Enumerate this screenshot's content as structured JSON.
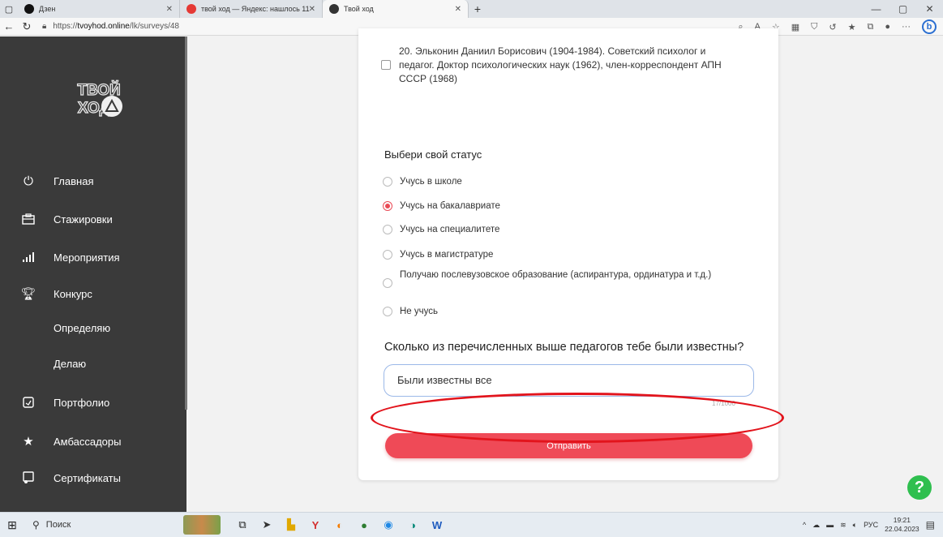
{
  "browser": {
    "tabs": [
      {
        "title": "Дзен",
        "favicon_color": "#111111"
      },
      {
        "title": "твой ход — Яндекс: нашлось 11",
        "favicon_color": "#e53935"
      },
      {
        "title": "Твой ход",
        "favicon_color": "#333333"
      }
    ],
    "url_prefix": "https://",
    "url_host": "tvoyhod.online",
    "url_path": "/lk/surveys/48",
    "new_tab": "+",
    "win_minimize": "—",
    "win_restore": "▢",
    "win_close": "✕",
    "more": "···",
    "bing": "b"
  },
  "sidebar": {
    "logo_lines": [
      "ТВОЙ",
      "ХОД"
    ],
    "items": [
      {
        "label": "Главная",
        "icon": "power-icon"
      },
      {
        "label": "Стажировки",
        "icon": "briefcase-icon"
      },
      {
        "label": "Мероприятия",
        "icon": "bars-icon"
      },
      {
        "label": "Конкурс",
        "icon": "trophy-icon"
      },
      {
        "label": "Определяю",
        "icon": ""
      },
      {
        "label": "Делаю",
        "icon": ""
      },
      {
        "label": "Портфолио",
        "icon": "portfolio-icon"
      },
      {
        "label": "Амбассадоры",
        "icon": "star-icon"
      },
      {
        "label": "Сертификаты",
        "icon": "certificate-icon"
      }
    ]
  },
  "survey": {
    "option_20": "20. Эльконин Даниил Борисович (1904-1984). Советский психолог и педагог. Доктор психологических наук (1962), член-корреспондент АПН СССР (1968)",
    "status_title": "Выбери свой статус",
    "status_options": [
      {
        "label": "Учусь в школе",
        "checked": false
      },
      {
        "label": "Учусь на бакалавриате",
        "checked": true
      },
      {
        "label": "Учусь на специалитете",
        "checked": false
      },
      {
        "label": "Учусь в магистратуре",
        "checked": false
      },
      {
        "label": "Получаю послевузовское образование (аспирантура, ординатура и т.д.)",
        "checked": false
      },
      {
        "label": "Не учусь",
        "checked": false
      }
    ],
    "question_title": "Сколько из перечисленных выше педагогов тебе были известны?",
    "answer_value": "Были известны все",
    "char_counter": "17/1000",
    "submit_label": "Отправить"
  },
  "help_label": "?",
  "taskbar": {
    "search_label": "Поиск",
    "lang": "РУС",
    "time": "19:21",
    "date": "22.04.2023"
  },
  "colors": {
    "accent": "#ef4a57",
    "sidebar_bg": "#3a3a3a",
    "annotation": "#e2141c",
    "help": "#2fbf4f"
  }
}
